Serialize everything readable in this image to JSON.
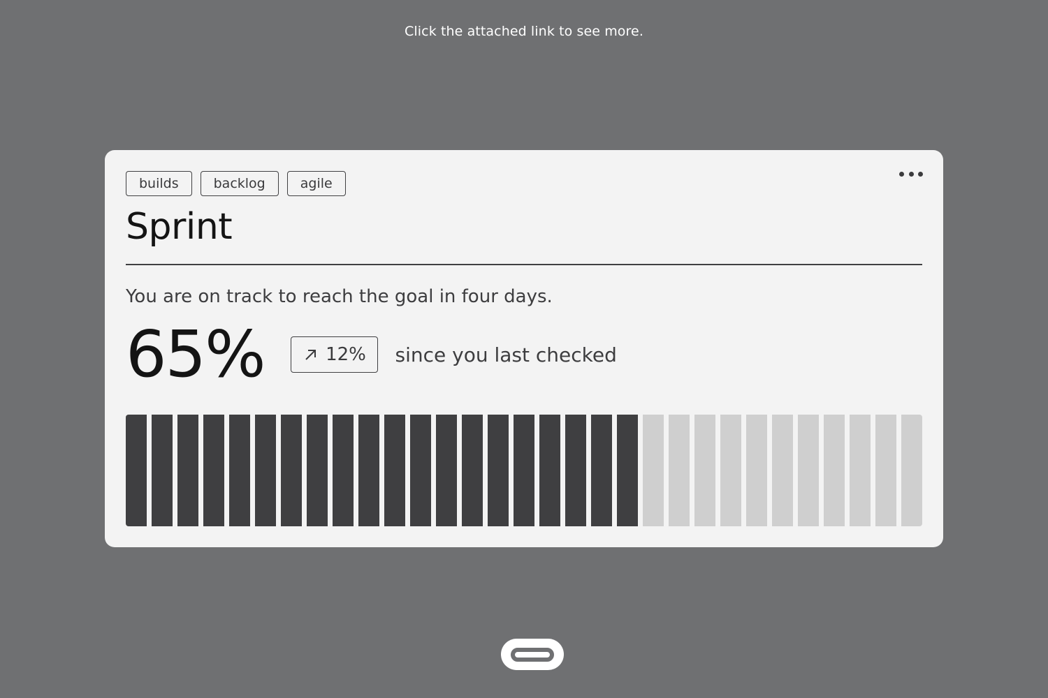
{
  "page": {
    "top_note": "Click the attached link to see more."
  },
  "card": {
    "tags": [
      "builds",
      "backlog",
      "agile"
    ],
    "title": "Sprint",
    "subtitle": "You are on track to reach the goal in four days.",
    "progress_value": "65%",
    "delta": {
      "icon": "arrow-up-right-icon",
      "value": "12%"
    },
    "since_label": "since you last checked",
    "progress_bar": {
      "total_segments": 31,
      "filled_segments": 20,
      "progress_fraction": 0.65,
      "filled_color": "#3f3f41",
      "empty_color": "#cfcfcf"
    },
    "menu_icon": "more-horizontal-icon"
  },
  "footer": {
    "link_icon": "link-icon"
  },
  "colors": {
    "background": "#6f7072",
    "card": "#f3f3f3",
    "text_dark": "#141414",
    "text_muted": "#3d3d3f"
  }
}
